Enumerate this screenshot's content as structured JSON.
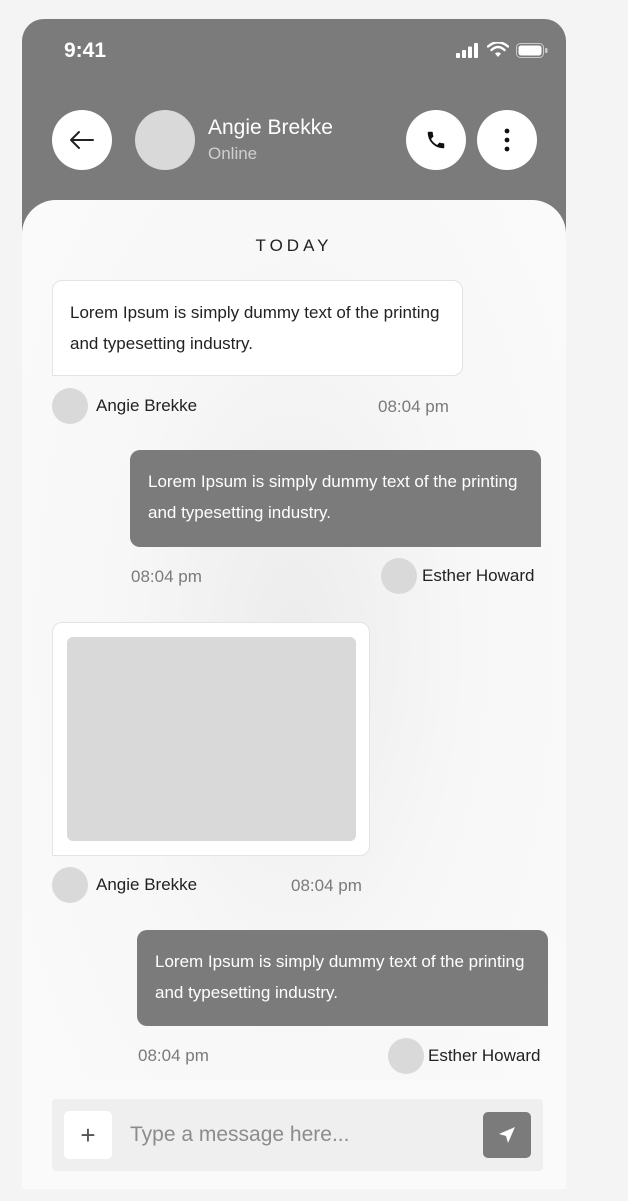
{
  "status_bar": {
    "time": "9:41",
    "icons": [
      "signal-icon",
      "wifi-icon",
      "battery-icon"
    ]
  },
  "header": {
    "contact_name": "Angie Brekke",
    "contact_status": "Online",
    "icons": [
      "arrow-left-icon",
      "phone-icon",
      "more-vertical-icon"
    ]
  },
  "chat": {
    "day_label": "TODAY",
    "messages": [
      {
        "direction": "incoming",
        "text": "Lorem Ipsum is simply dummy text of the printing and typesetting industry.",
        "sender": "Angie Brekke",
        "time": "08:04 pm"
      },
      {
        "direction": "outgoing",
        "text": "Lorem Ipsum is simply dummy text of the printing and typesetting industry.",
        "sender": "Esther Howard",
        "time": "08:04 pm"
      },
      {
        "direction": "incoming",
        "type": "image",
        "sender": "Angie Brekke",
        "time": "08:04 pm"
      },
      {
        "direction": "outgoing",
        "text": "Lorem Ipsum is simply dummy text of the printing and typesetting industry.",
        "sender": "Esther Howard",
        "time": "08:04 pm"
      }
    ]
  },
  "composer": {
    "placeholder": "Type a message here...",
    "value": "",
    "add_label": "+",
    "icons": [
      "plus-icon",
      "send-icon"
    ]
  },
  "colors": {
    "header_bg": "#7b7b7b",
    "outgoing_bubble": "#7b7b7b",
    "incoming_bubble": "#ffffff",
    "avatar_placeholder": "#d9d9d9"
  }
}
